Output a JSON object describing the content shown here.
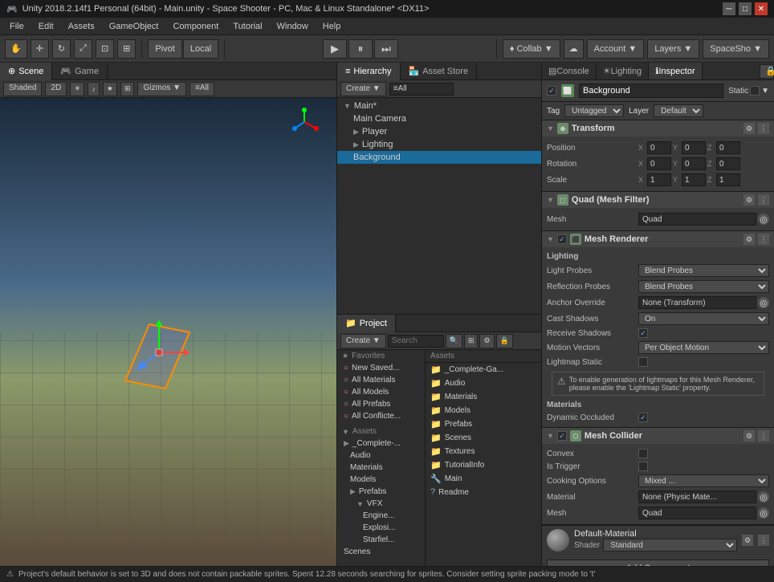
{
  "titlebar": {
    "title": "Unity 2018.2.14f1 Personal (64bit) - Main.unity - Space Shooter - PC, Mac & Linux Standalone* <DX11>",
    "minimize": "─",
    "maximize": "□",
    "close": "✕"
  },
  "menubar": {
    "items": [
      "File",
      "Edit",
      "Assets",
      "GameObject",
      "Component",
      "Tutorial",
      "Window",
      "Help"
    ]
  },
  "toolbar": {
    "tools": [
      "⊕",
      "↔",
      "↻",
      "⤢",
      "⊡",
      "⊞"
    ],
    "pivot_label": "Pivot",
    "local_label": "Local",
    "play": "▶",
    "pause": "⏸",
    "step": "⏭",
    "collab": "♦ Collab ▼",
    "cloud": "☁",
    "account": "Account ▼",
    "layers": "Layers ▼",
    "layout": "SpaceSho ▼"
  },
  "panels": {
    "scene_tab": "Scene",
    "game_tab": "Game",
    "shaded_label": "Shaded",
    "mode_label": "2D",
    "gizmos_label": "Gizmos ▼",
    "all_label": "≡All"
  },
  "hierarchy": {
    "title": "Hierarchy",
    "create_btn": "Create ▼",
    "search_placeholder": "≡All",
    "items": [
      {
        "label": "Main*",
        "indent": 0,
        "expanded": true,
        "icon": "▶"
      },
      {
        "label": "Main Camera",
        "indent": 1,
        "icon": ""
      },
      {
        "label": "Player",
        "indent": 1,
        "icon": "▶"
      },
      {
        "label": "Lighting",
        "indent": 1,
        "icon": "▶"
      },
      {
        "label": "Background",
        "indent": 1,
        "icon": "",
        "selected": true
      }
    ]
  },
  "asset_store": {
    "title": "Asset Store"
  },
  "project": {
    "title": "Project",
    "create_btn": "Create ▼",
    "favorites_header": "Favorites",
    "favorites": [
      {
        "label": "New Saved...",
        "icon": "★"
      },
      {
        "label": "All Materials",
        "icon": "○"
      },
      {
        "label": "All Models",
        "icon": "○"
      },
      {
        "label": "All Prefabs",
        "icon": "○"
      },
      {
        "label": "All Conflicte...",
        "icon": "○"
      }
    ],
    "assets_header": "Assets",
    "asset_folders": [
      {
        "label": "_Complete-Ga...",
        "indent": 0,
        "icon": "📁"
      },
      {
        "label": "Audio",
        "indent": 1,
        "icon": "📁"
      },
      {
        "label": "Materials",
        "indent": 1,
        "icon": "📁"
      },
      {
        "label": "Models",
        "indent": 1,
        "icon": "📁"
      },
      {
        "label": "Prefabs",
        "indent": 1,
        "icon": "📁"
      },
      {
        "label": "VFX",
        "indent": 2,
        "icon": "📁"
      },
      {
        "label": "Engines...",
        "indent": 3,
        "icon": "📁"
      },
      {
        "label": "Explosi...",
        "indent": 3,
        "icon": "📁"
      },
      {
        "label": "Starfiel...",
        "indent": 3,
        "icon": "📁"
      },
      {
        "label": "Scenes",
        "indent": 0,
        "icon": "📁"
      }
    ],
    "right_folders": [
      {
        "label": "_Complete-Ga...",
        "icon": "📁"
      },
      {
        "label": "Audio",
        "icon": "📁"
      },
      {
        "label": "Materials",
        "icon": "📁"
      },
      {
        "label": "Models",
        "icon": "📁"
      },
      {
        "label": "Prefabs",
        "icon": "📁"
      },
      {
        "label": "Scenes",
        "icon": "📁"
      },
      {
        "label": "Textures",
        "icon": "📁"
      },
      {
        "label": "TutorialInfo",
        "icon": "📁"
      },
      {
        "label": "Main",
        "icon": "🔧"
      },
      {
        "label": "Readme",
        "icon": "?"
      }
    ]
  },
  "inspector": {
    "tabs": [
      "Console",
      "Lighting",
      "Inspector"
    ],
    "active_tab": "Inspector",
    "object": {
      "name": "Background",
      "enabled_checkbox": true,
      "static_label": "Static",
      "static_dropdown": "▼",
      "tag_label": "Tag",
      "tag_value": "Untagged",
      "layer_label": "Layer",
      "layer_value": "Default"
    },
    "transform": {
      "title": "Transform",
      "position_label": "Position",
      "rotation_label": "Rotation",
      "scale_label": "Scale",
      "pos_x": "0",
      "pos_y": "0",
      "pos_z": "0",
      "rot_x": "0",
      "rot_y": "0",
      "rot_z": "0",
      "scale_x": "1",
      "scale_y": "1",
      "scale_z": "1"
    },
    "mesh_filter": {
      "title": "Quad (Mesh Filter)",
      "mesh_label": "Mesh",
      "mesh_value": "Quad"
    },
    "mesh_renderer": {
      "title": "Mesh Renderer",
      "lighting_header": "Lighting",
      "light_probes_label": "Light Probes",
      "light_probes_value": "Blend Probes",
      "reflection_probes_label": "Reflection Probes",
      "reflection_probes_value": "Blend Probes",
      "anchor_override_label": "Anchor Override",
      "anchor_override_value": "None (Transform)",
      "cast_shadows_label": "Cast Shadows",
      "cast_shadows_value": "On",
      "receive_shadows_label": "Receive Shadows",
      "receive_shadows_checked": true,
      "motion_vectors_label": "Motion Vectors",
      "motion_vectors_value": "Per Object Motion",
      "lightmap_static_label": "Lightmap Static",
      "lightmap_static_checked": false,
      "info_text": "To enable generation of lightmaps for this Mesh Renderer, please enable the 'Lightmap Static' property.",
      "materials_label": "Materials",
      "dynamic_occluded_label": "Dynamic Occluded",
      "dynamic_occluded_checked": true
    },
    "mesh_collider": {
      "title": "Mesh Collider",
      "convex_label": "Convex",
      "convex_checked": false,
      "is_trigger_label": "Is Trigger",
      "is_trigger_checked": false,
      "cooking_options_label": "Cooking Options",
      "cooking_options_value": "Mixed ...",
      "material_label": "Material",
      "material_value": "None (Physic Mate...",
      "mesh_label": "Mesh",
      "mesh_value": "Quad"
    },
    "material": {
      "name": "Default-Material",
      "shader_label": "Shader",
      "shader_value": "Standard"
    },
    "add_component_label": "Add Component"
  },
  "statusbar": {
    "text": "Project's default behavior is set to 3D and does not contain packable sprites. Spent 12.28 seconds searching for sprites. Consider setting sprite packing mode to 't'"
  }
}
